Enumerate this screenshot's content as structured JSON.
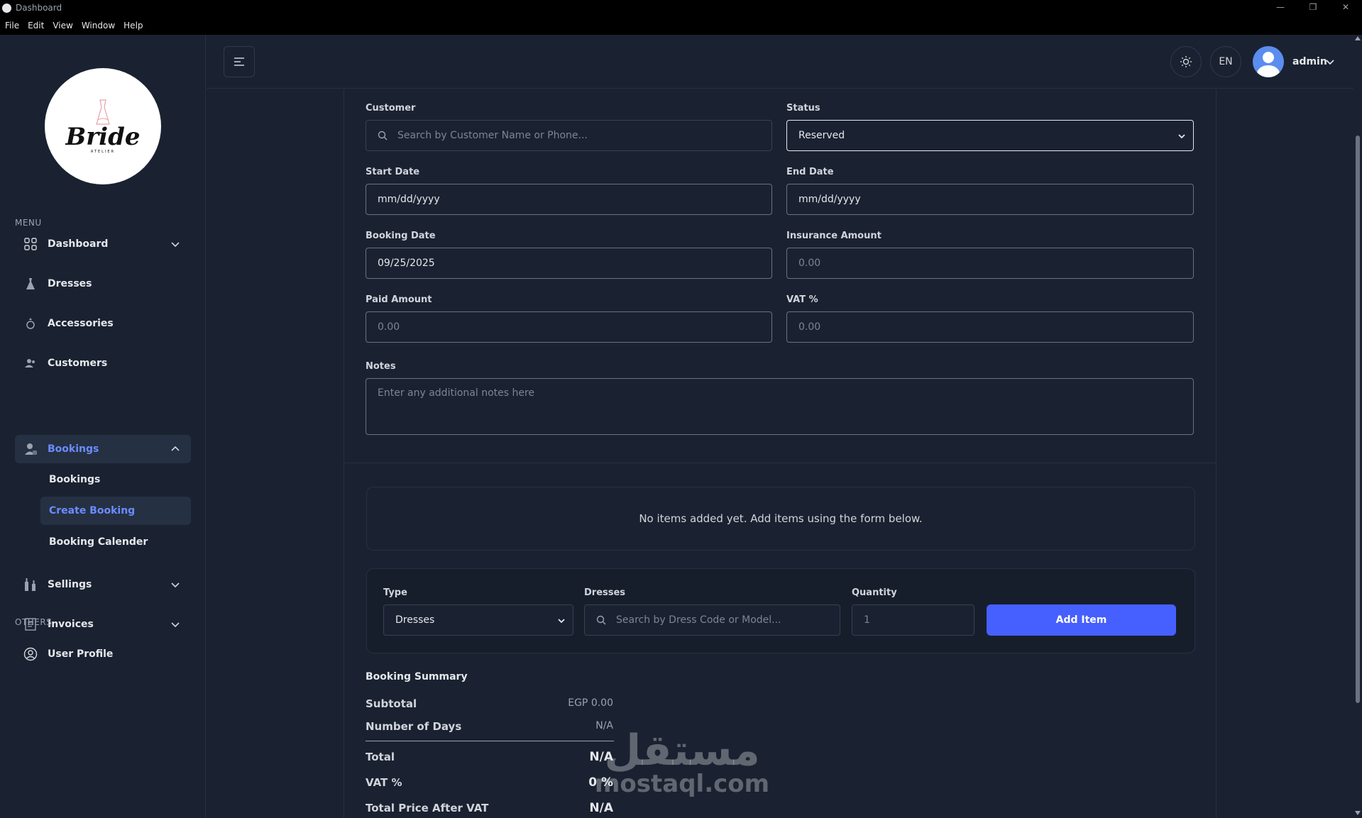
{
  "window": {
    "title": "Dashboard",
    "controls": [
      "—",
      "❐",
      "✕"
    ]
  },
  "menubar": [
    "File",
    "Edit",
    "View",
    "Window",
    "Help"
  ],
  "sidebar": {
    "logo": {
      "brand": "Bride",
      "sub": "ATELIER"
    },
    "menu_label": "MENU",
    "others_label": "OTHERS",
    "items": [
      {
        "label": "Dashboard",
        "icon": "grid-icon"
      },
      {
        "label": "Dresses",
        "icon": "dress-icon"
      },
      {
        "label": "Accessories",
        "icon": "ring-icon"
      },
      {
        "label": "Customers",
        "icon": "users-icon"
      },
      {
        "label": "Bookings",
        "icon": "booking-icon"
      },
      {
        "label": "Sellings",
        "icon": "bottles-icon"
      },
      {
        "label": "Invoices",
        "icon": "invoice-icon"
      },
      {
        "label": "User Profile",
        "icon": "user-circle-icon"
      }
    ],
    "booking_sub": [
      "Bookings",
      "Create Booking",
      "Booking Calender"
    ]
  },
  "header": {
    "language": "EN",
    "user_name": "admin"
  },
  "form": {
    "customer": {
      "label": "Customer",
      "placeholder": "Search by Customer Name or Phone..."
    },
    "status": {
      "label": "Status",
      "value": "Reserved"
    },
    "start_date": {
      "label": "Start Date",
      "value": "mm/dd/yyyy"
    },
    "end_date": {
      "label": "End Date",
      "value": "mm/dd/yyyy"
    },
    "booking_date": {
      "label": "Booking Date",
      "value": "09/25/2025"
    },
    "insurance_amount": {
      "label": "Insurance Amount",
      "placeholder": "0.00"
    },
    "paid_amount": {
      "label": "Paid Amount",
      "placeholder": "0.00"
    },
    "vat": {
      "label": "VAT %",
      "placeholder": "0.00"
    },
    "notes": {
      "label": "Notes",
      "placeholder": "Enter any additional notes here"
    }
  },
  "items": {
    "empty_message": "No items added yet. Add items using the form below.",
    "type": {
      "label": "Type",
      "value": "Dresses"
    },
    "dresses": {
      "label": "Dresses",
      "placeholder": "Search by Dress Code or Model..."
    },
    "quantity": {
      "label": "Quantity",
      "value": "1"
    },
    "add_button": "Add Item"
  },
  "summary": {
    "title": "Booking Summary",
    "subtotal_label": "Subtotal",
    "subtotal_value": "EGP 0.00",
    "days_label": "Number of Days",
    "days_value": "N/A",
    "total_label": "Total",
    "total_value": "N/A",
    "vat_label": "VAT %",
    "vat_value": "0 %",
    "after_vat_label": "Total Price After VAT",
    "after_vat_value": "N/A"
  },
  "watermark": {
    "arabic": "مستقل",
    "latin": "mostaql.com"
  },
  "colors": {
    "accent": "#465fff",
    "active_text": "#6b8cff",
    "background": "#1a2231"
  }
}
